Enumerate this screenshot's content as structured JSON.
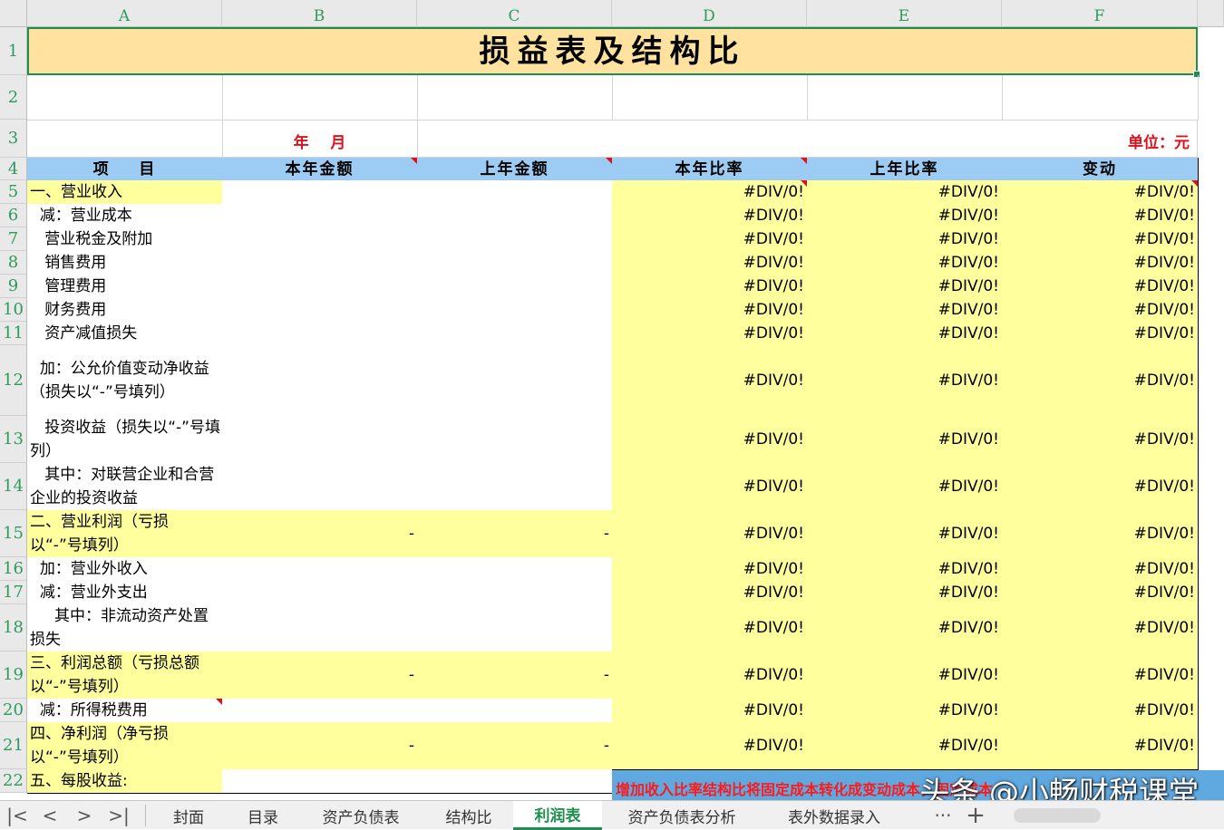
{
  "columns": [
    "A",
    "B",
    "C",
    "D",
    "E",
    "F"
  ],
  "title": "损益表及结构比",
  "row3": {
    "period": "年    月",
    "unit": "单位：元"
  },
  "header": [
    "项    目",
    "本年金额",
    "上年金额",
    "本年比率",
    "上年比率",
    "变动"
  ],
  "rows": [
    {
      "num": "5",
      "item": "一、营业收入",
      "b": "",
      "c": "",
      "d": "#DIV/0!",
      "e": "#DIV/0!",
      "f": "#DIV/0!"
    },
    {
      "num": "6",
      "item": "  减：营业成本",
      "b": "",
      "c": "",
      "d": "#DIV/0!",
      "e": "#DIV/0!",
      "f": "#DIV/0!"
    },
    {
      "num": "7",
      "item": "   营业税金及附加",
      "b": "",
      "c": "",
      "d": "#DIV/0!",
      "e": "#DIV/0!",
      "f": "#DIV/0!"
    },
    {
      "num": "8",
      "item": "   销售费用",
      "b": "",
      "c": "",
      "d": "#DIV/0!",
      "e": "#DIV/0!",
      "f": "#DIV/0!"
    },
    {
      "num": "9",
      "item": "   管理费用",
      "b": "",
      "c": "",
      "d": "#DIV/0!",
      "e": "#DIV/0!",
      "f": "#DIV/0!"
    },
    {
      "num": "10",
      "item": "   财务费用",
      "b": "",
      "c": "",
      "d": "#DIV/0!",
      "e": "#DIV/0!",
      "f": "#DIV/0!"
    },
    {
      "num": "11",
      "item": "   资产减值损失",
      "b": "",
      "c": "",
      "d": "#DIV/0!",
      "e": "#DIV/0!",
      "f": "#DIV/0!"
    },
    {
      "num": "12",
      "item": "  加：公允价值变动净收益（损失以“-”号填列）",
      "b": "",
      "c": "",
      "d": "#DIV/0!",
      "e": "#DIV/0!",
      "f": "#DIV/0!"
    },
    {
      "num": "13",
      "item": "   投资收益（损失以“-”号填列）",
      "b": "",
      "c": "",
      "d": "#DIV/0!",
      "e": "#DIV/0!",
      "f": "#DIV/0!"
    },
    {
      "num": "14",
      "item": "   其中：对联营企业和合营企业的投资收益",
      "b": "",
      "c": "",
      "d": "#DIV/0!",
      "e": "#DIV/0!",
      "f": "#DIV/0!"
    },
    {
      "num": "15",
      "item": "二、营业利润（亏损以“-”号填列）",
      "b": "-",
      "c": "-",
      "d": "#DIV/0!",
      "e": "#DIV/0!",
      "f": "#DIV/0!"
    },
    {
      "num": "16",
      "item": "  加：营业外收入",
      "b": "",
      "c": "",
      "d": "#DIV/0!",
      "e": "#DIV/0!",
      "f": "#DIV/0!"
    },
    {
      "num": "17",
      "item": "  减：营业外支出",
      "b": "",
      "c": "",
      "d": "#DIV/0!",
      "e": "#DIV/0!",
      "f": "#DIV/0!"
    },
    {
      "num": "18",
      "item": "     其中：非流动资产处置损失",
      "b": "",
      "c": "",
      "d": "#DIV/0!",
      "e": "#DIV/0!",
      "f": "#DIV/0!"
    },
    {
      "num": "19",
      "item": "三、利润总额（亏损总额以“-”号填列）",
      "b": "-",
      "c": "-",
      "d": "#DIV/0!",
      "e": "#DIV/0!",
      "f": "#DIV/0!"
    },
    {
      "num": "20",
      "item": "  减：所得税费用",
      "b": "",
      "c": "",
      "d": "#DIV/0!",
      "e": "#DIV/0!",
      "f": "#DIV/0!"
    },
    {
      "num": "21",
      "item": "四、净利润（净亏损以“-”号填列）",
      "b": "-",
      "c": "-",
      "d": "#DIV/0!",
      "e": "#DIV/0!",
      "f": "#DIV/0!"
    },
    {
      "num": "22",
      "item": "五、每股收益:",
      "b": "",
      "c": "",
      "d": "",
      "e": "",
      "f": ""
    }
  ],
  "row_numbers": {
    "r1": "1",
    "r2": "2",
    "r3": "3",
    "r4": "4"
  },
  "note": "增加收入比率结构比将固定成本转化成变动成本，固定成本",
  "watermark": "头条 @小畅财税课堂",
  "tabs": [
    "封面",
    "目录",
    "资产负债表",
    "结构比",
    "利润表",
    "资产负债表分析",
    "表外数据录入"
  ],
  "active_tab": "利润表",
  "tab_more": "···",
  "tab_add": "+",
  "nav_icons": [
    "first-sheet-icon",
    "prev-sheet-icon",
    "next-sheet-icon",
    "last-sheet-icon"
  ],
  "nav_glyphs": [
    "|<",
    "<",
    ">",
    ">|"
  ],
  "colors": {
    "title_fill": "#ffe29f",
    "header_fill": "#9ccbf3",
    "yellow_fill": "#ffff9e",
    "red_text": "#e0101a",
    "selection": "#1e8f4e",
    "tab_active": "#1e8f4e"
  }
}
